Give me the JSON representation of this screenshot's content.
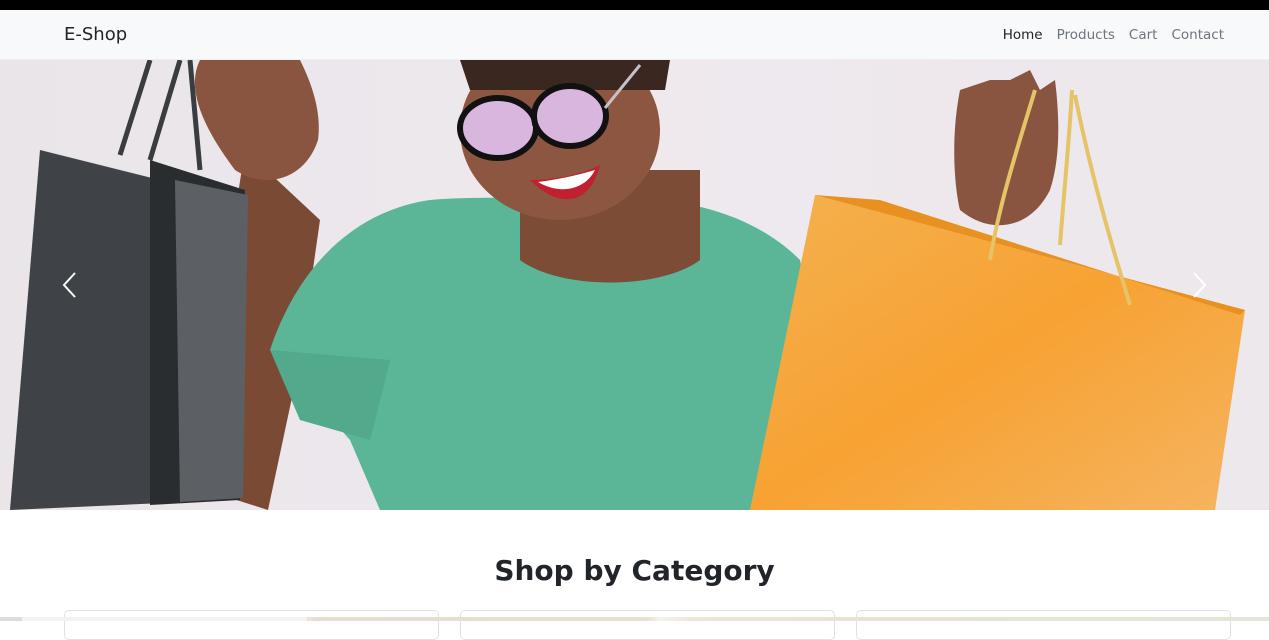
{
  "nav": {
    "brand": "E-Shop",
    "links": [
      {
        "label": "Home",
        "active": true
      },
      {
        "label": "Products",
        "active": false
      },
      {
        "label": "Cart",
        "active": false
      },
      {
        "label": "Contact",
        "active": false
      }
    ]
  },
  "carousel": {
    "prev_icon": "chevron-left-icon",
    "next_icon": "chevron-right-icon"
  },
  "categories": {
    "title": "Shop by Category"
  },
  "colors": {
    "navbar_bg": "#f8f9fa",
    "shirt": "#5bb597",
    "bag_orange": "#f6a53b",
    "bag_dark": "#3f4347"
  }
}
